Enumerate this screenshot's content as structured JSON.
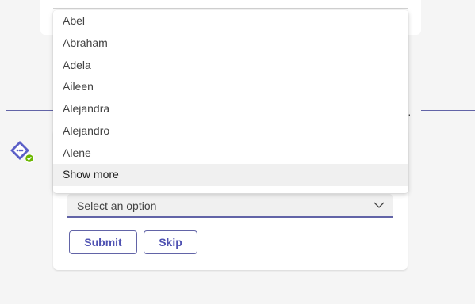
{
  "dropdown": {
    "options": [
      "Abel",
      "Abraham",
      "Adela",
      "Aileen",
      "Alejandra",
      "Alejandro",
      "Alene"
    ],
    "show_more_label": "Show more"
  },
  "card": {
    "select": {
      "placeholder": "Select an option",
      "chevron_icon": "chevron-down-icon"
    },
    "buttons": {
      "submit_label": "Submit",
      "skip_label": "Skip"
    }
  },
  "bot": {
    "avatar_icon": "bot-avatar-icon",
    "status_icon": "available-status-icon"
  },
  "divider_text": "·",
  "colors": {
    "accent": "#6264a7",
    "button_text": "#4f52b2",
    "background": "#f5f5f5",
    "status_green": "#6bb700"
  }
}
